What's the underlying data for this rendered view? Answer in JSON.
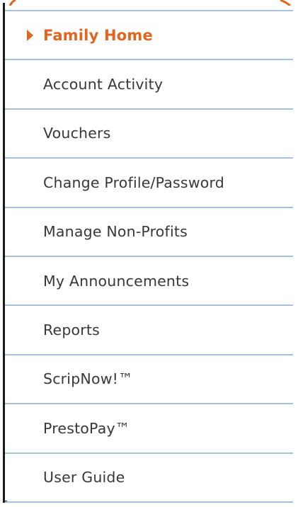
{
  "nav": {
    "items": [
      {
        "label": "Family Home",
        "active": true
      },
      {
        "label": "Account Activity",
        "active": false
      },
      {
        "label": "Vouchers",
        "active": false
      },
      {
        "label": "Change Profile/Password",
        "active": false
      },
      {
        "label": "Manage Non-Profits",
        "active": false
      },
      {
        "label": "My Announcements",
        "active": false
      },
      {
        "label": "Reports",
        "active": false
      },
      {
        "label": "ScripNow!™",
        "active": false
      },
      {
        "label": "PrestoPay™",
        "active": false
      },
      {
        "label": "User Guide",
        "active": false
      }
    ]
  },
  "colors": {
    "active_text": "#e0651e",
    "text": "#383838",
    "divider": "#a9c1d9",
    "border": "#1a1a1a",
    "accent": "#e0651e"
  }
}
